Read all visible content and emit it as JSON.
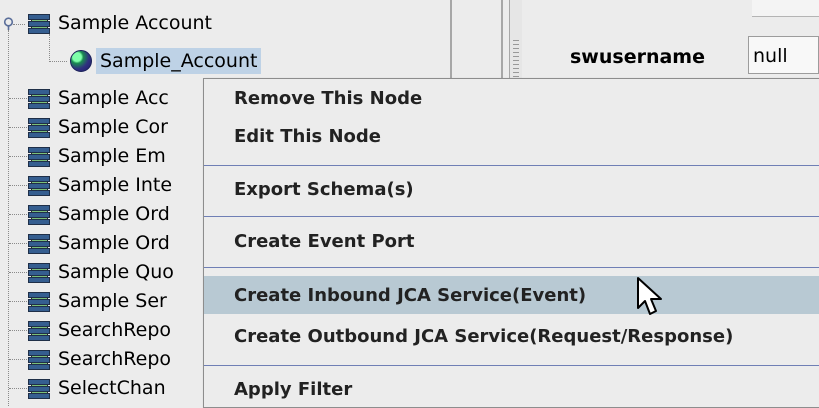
{
  "tree": {
    "root_label": "Sample Account",
    "child_label": "Sample_Account",
    "items": [
      "Sample Acc",
      "Sample Cor",
      "Sample Em",
      "Sample Inte",
      "Sample Ord",
      "Sample Ord",
      "Sample Quo",
      "Sample Ser",
      "SearchRepo",
      "SearchRepo",
      "SelectChan"
    ]
  },
  "properties": {
    "label": "swusername",
    "value": "null"
  },
  "context_menu": {
    "items": [
      "Remove This Node",
      "Edit This Node",
      "Export Schema(s)",
      "Create Event Port",
      "Create Inbound JCA Service(Event)",
      "Create Outbound JCA Service(Request/Response)",
      "Apply Filter"
    ],
    "highlighted": "Create Inbound JCA Service(Event)"
  },
  "icons": {
    "package": "package-icon",
    "object": "object-orb-icon",
    "toggle": "expanded-toggle-icon",
    "cursor": "mouse-cursor-icon"
  },
  "colors": {
    "selection": "#bed2e6",
    "menu_highlight": "#b8c9d3",
    "separator": "#6f7fb5"
  }
}
